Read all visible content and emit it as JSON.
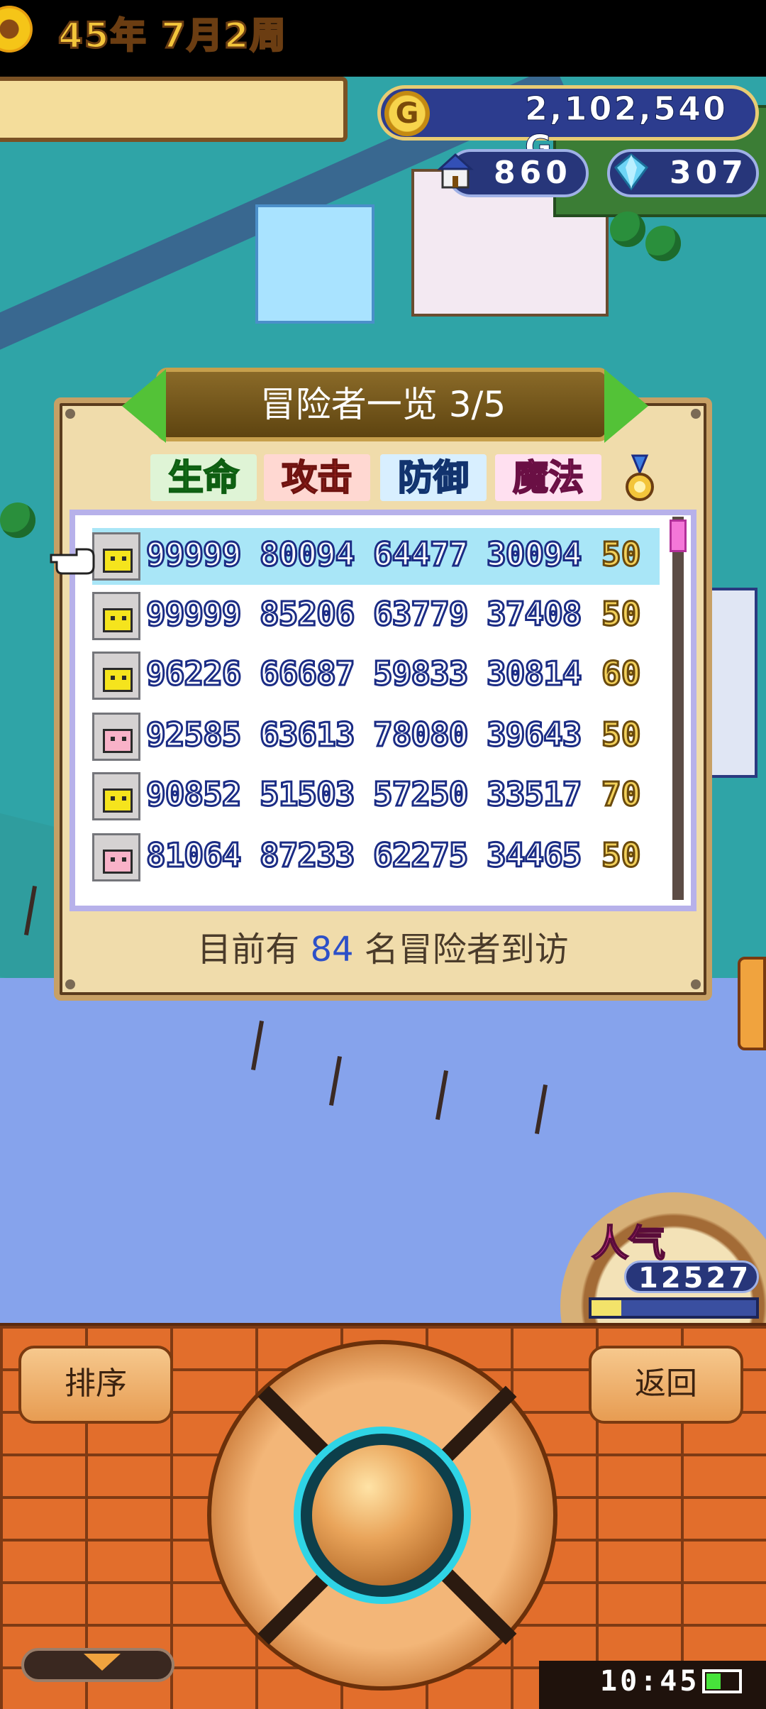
{
  "hud": {
    "date": "45年 7月2周",
    "gold": "2,102,540 G",
    "gold_icon": "G",
    "town_rank": "860",
    "crystals": "307"
  },
  "dialog": {
    "title": "冒险者一览 3/5",
    "tabs": [
      "生命",
      "攻击",
      "防御",
      "魔法"
    ],
    "rows": [
      {
        "face": "yellow",
        "hp": "99999",
        "atk": "80094",
        "def": "64477",
        "mag": "30094",
        "lvl": "50"
      },
      {
        "face": "yellow",
        "hp": "99999",
        "atk": "85206",
        "def": "63779",
        "mag": "37408",
        "lvl": "50"
      },
      {
        "face": "yellow",
        "hp": "96226",
        "atk": "66687",
        "def": "59833",
        "mag": "30814",
        "lvl": "60"
      },
      {
        "face": "pink",
        "hp": "92585",
        "atk": "63613",
        "def": "78080",
        "mag": "39643",
        "lvl": "50"
      },
      {
        "face": "yellow",
        "hp": "90852",
        "atk": "51503",
        "def": "57250",
        "mag": "33517",
        "lvl": "70"
      },
      {
        "face": "pink",
        "hp": "81064",
        "atk": "87233",
        "def": "62275",
        "mag": "34465",
        "lvl": "50"
      }
    ],
    "footer_prefix": "目前有",
    "footer_count": "84",
    "footer_suffix": "名冒险者到访"
  },
  "popularity": {
    "label": "人气",
    "value": "12527",
    "fill_fraction": 0.18
  },
  "controls": {
    "sort_label": "排序",
    "back_label": "返回"
  },
  "status": {
    "time": "10:45"
  }
}
